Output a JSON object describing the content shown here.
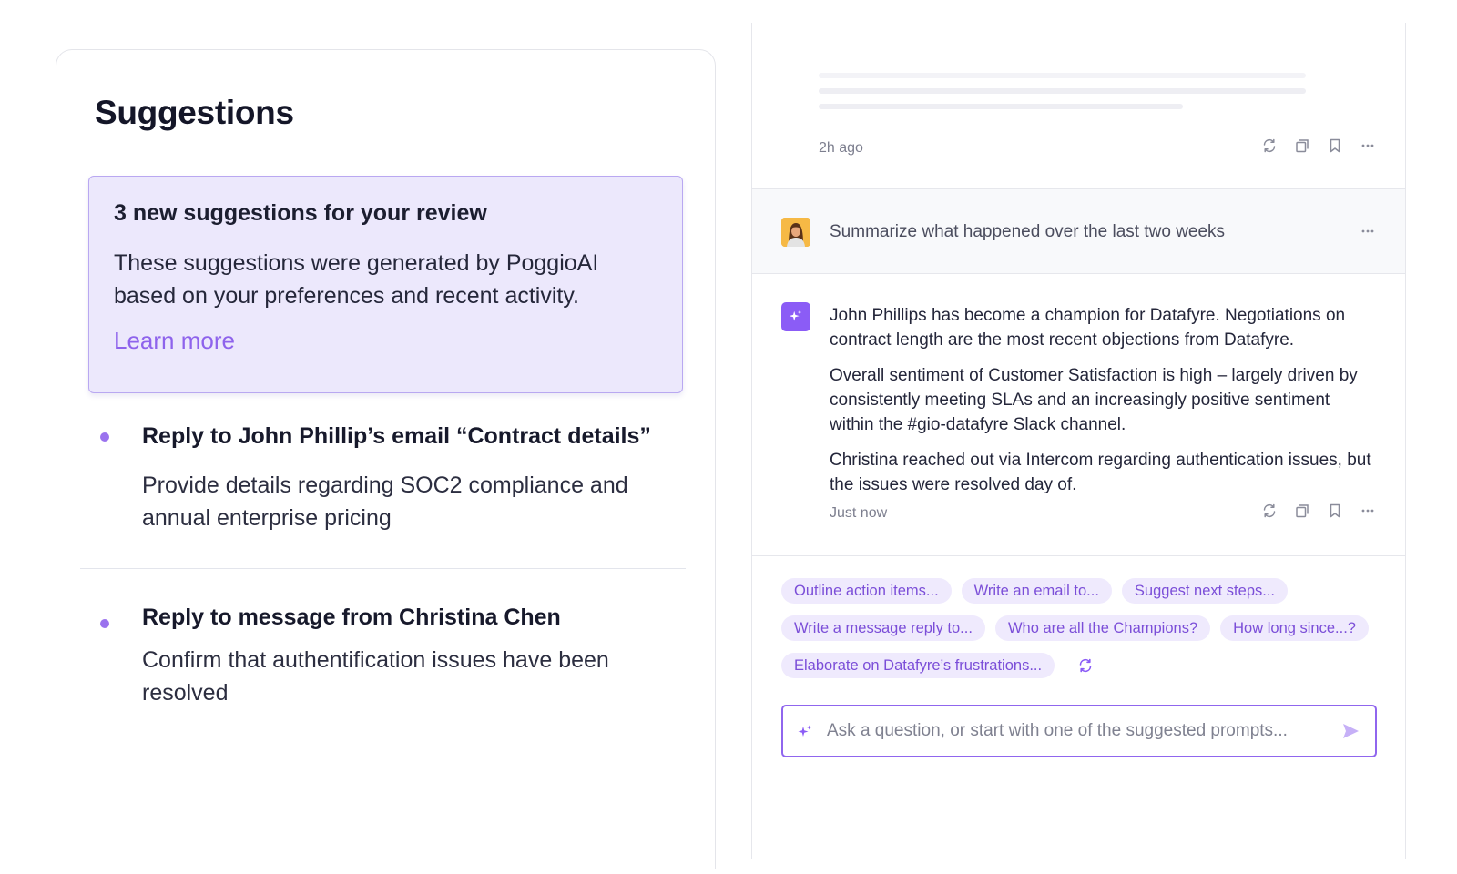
{
  "suggestions": {
    "title": "Suggestions",
    "notice": {
      "title": "3 new suggestions for your review",
      "body": "These suggestions were generated by PoggioAI based on your preferences and recent activity.",
      "link": "Learn more"
    },
    "items": [
      {
        "title": "Reply to John Phillip’s email “Contract details”",
        "description": "Provide details regarding SOC2 compliance and annual enterprise pricing"
      },
      {
        "title": "Reply to message from Christina Chen",
        "description": "Confirm that authentification issues have been resolved"
      }
    ]
  },
  "chat": {
    "previous_message": {
      "time": "2h ago"
    },
    "user_message": {
      "text": "Summarize what happened over the last two weeks"
    },
    "ai_message": {
      "paragraphs": [
        "John Phillips has become a champion for Datafyre. Negotiations on contract length are the most recent objections from Datafyre.",
        "Overall sentiment of Customer Satisfaction is high – largely driven by consistently meeting SLAs and an increasingly positive sentiment within the #gio-datafyre Slack channel.",
        "Christina reached out via Intercom regarding authentication issues, but the issues were resolved day of."
      ],
      "time": "Just now"
    },
    "action_icons": [
      "regenerate-icon",
      "copy-icon",
      "bookmark-icon",
      "more-icon"
    ],
    "suggested_prompts": [
      [
        "Outline action items...",
        "Write an email to...",
        "Suggest next steps..."
      ],
      [
        "Write a message reply to...",
        "Who are all the Champions?",
        "How long since...?"
      ],
      [
        "Elaborate on Datafyre’s frustrations..."
      ]
    ],
    "input": {
      "placeholder": "Ask a question, or start with one of the suggested prompts...",
      "value": ""
    }
  },
  "colors": {
    "accent": "#8b5cf6",
    "notice_bg": "#ece8fc",
    "chip_bg": "#efeafd",
    "chip_text": "#7b4ed8"
  }
}
